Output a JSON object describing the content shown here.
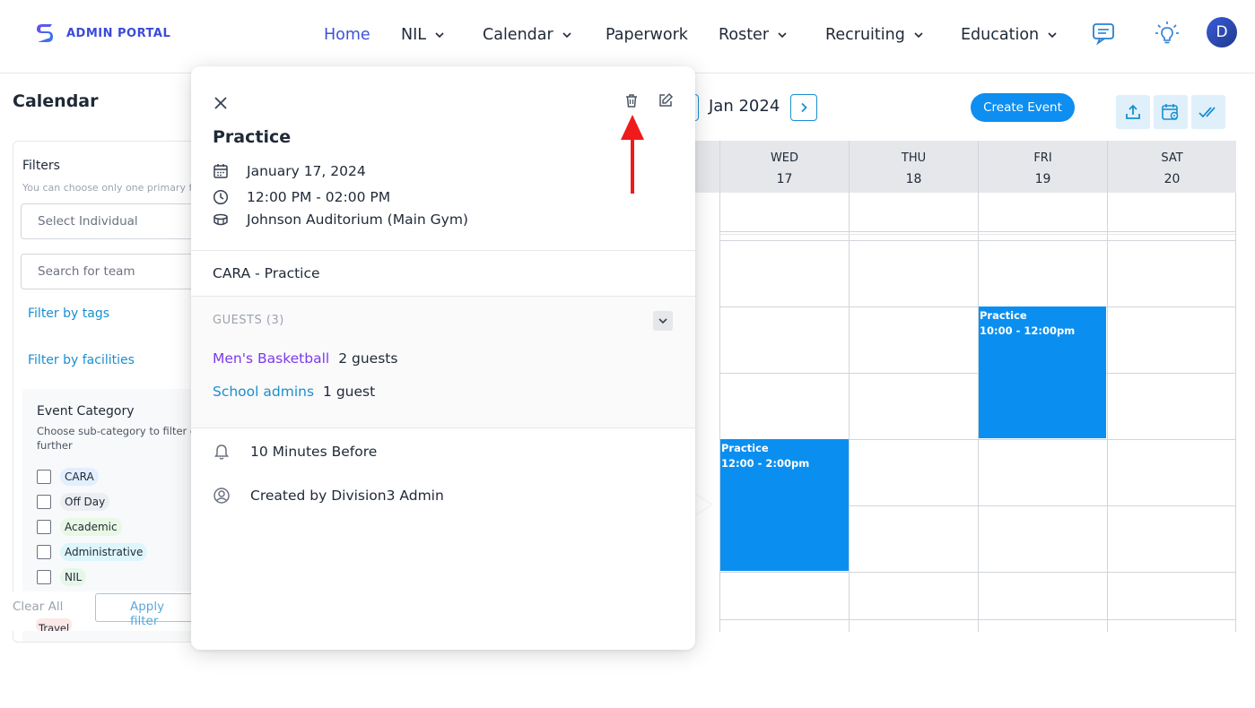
{
  "brand": {
    "name": "ADMIN PORTAL"
  },
  "nav": {
    "items": [
      {
        "label": "Home",
        "active": true,
        "dropdown": false
      },
      {
        "label": "NIL",
        "active": false,
        "dropdown": true
      },
      {
        "label": "Calendar",
        "active": false,
        "dropdown": true
      },
      {
        "label": "Paperwork",
        "active": false,
        "dropdown": false
      },
      {
        "label": "Roster",
        "active": false,
        "dropdown": true
      },
      {
        "label": "Recruiting",
        "active": false,
        "dropdown": true
      },
      {
        "label": "Education",
        "active": false,
        "dropdown": true
      }
    ],
    "icons": [
      "chat-icon",
      "lightbulb-icon"
    ],
    "avatar_initial": "D"
  },
  "sidebar": {
    "title": "Calendar",
    "filters_title": "Filters",
    "filters_note": "You can choose only one primary f",
    "select_individual_placeholder": "Select Individual",
    "search_team_placeholder": "Search for team",
    "filter_by_tags": "Filter by tags",
    "filter_by_facilities": "Filter by facilities",
    "event_category": {
      "title": "Event Category",
      "description": "Choose sub-category to filter o further",
      "items": [
        {
          "label": "CARA",
          "color": "#e3efff"
        },
        {
          "label": "Off Day",
          "color": "#eceef1"
        },
        {
          "label": "Academic",
          "color": "#e8f8e4"
        },
        {
          "label": "Administrative",
          "color": "#def5fb"
        },
        {
          "label": "NIL",
          "color": "#e6f7ea"
        }
      ],
      "partial_item": "Travel"
    },
    "clear_all": "Clear All",
    "apply_filters": "Apply filter"
  },
  "calendar": {
    "range_label": "Jan 2024",
    "create_event": "Create Event",
    "toolbar_icons": [
      "upload-icon",
      "calendar-settings-icon",
      "check-all-icon"
    ],
    "days": [
      {
        "name": "WED",
        "date": "17"
      },
      {
        "name": "THU",
        "date": "18"
      },
      {
        "name": "FRI",
        "date": "19"
      },
      {
        "name": "SAT",
        "date": "20"
      }
    ],
    "events": [
      {
        "title": "Practice",
        "time": "10:00 - 12:00pm",
        "day": "FRI"
      },
      {
        "title": "Practice",
        "time": "12:00 - 2:00pm",
        "day": "WED"
      }
    ]
  },
  "popup": {
    "title": "Practice",
    "date": "January 17, 2024",
    "time": "12:00 PM - 02:00 PM",
    "location": "Johnson Auditorium (Main Gym)",
    "description": "CARA - Practice",
    "guests_label": "GUESTS (3)",
    "guests": [
      {
        "name": "Men's Basketball",
        "count": "2 guests"
      },
      {
        "name": "School admins",
        "count": "1 guest"
      }
    ],
    "reminder": "10 Minutes Before",
    "created_by": "Created by Division3 Admin",
    "colors": {
      "red_arrow": "#ef1b1b",
      "event_blue": "#0a8ff0",
      "accent": "#3f51d9"
    }
  }
}
